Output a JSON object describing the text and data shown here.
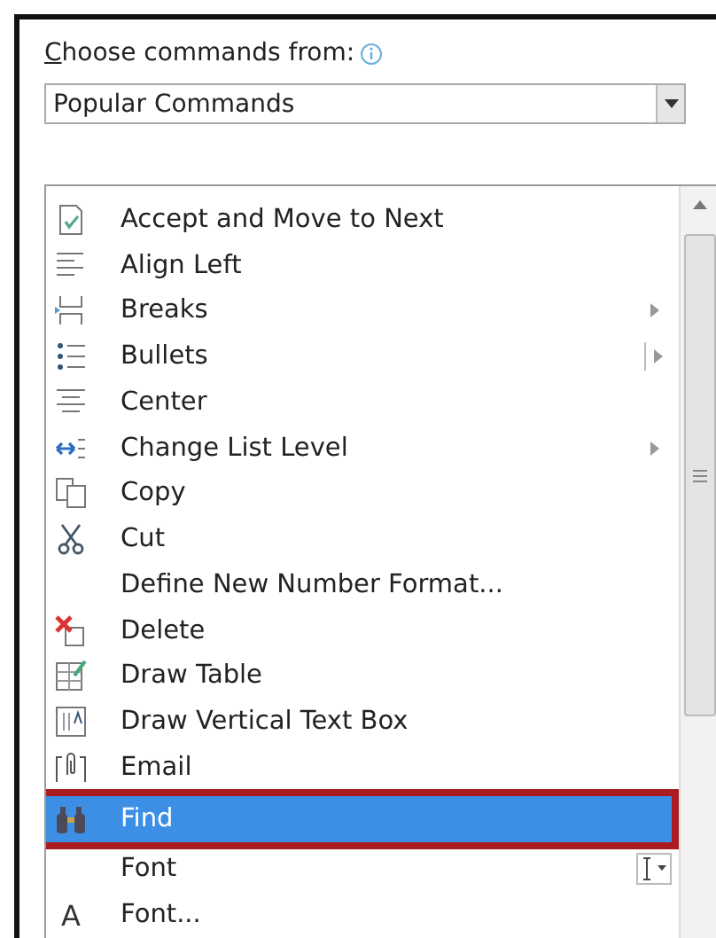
{
  "label": "Choose commands from:",
  "source": {
    "value": "Popular Commands"
  },
  "commands": [
    {
      "label": "Accept and Move to Next",
      "selected": false
    },
    {
      "label": "Align Left",
      "selected": false
    },
    {
      "label": "Breaks",
      "selected": false
    },
    {
      "label": "Bullets",
      "selected": false
    },
    {
      "label": "Center",
      "selected": false
    },
    {
      "label": "Change List Level",
      "selected": false
    },
    {
      "label": "Copy",
      "selected": false
    },
    {
      "label": "Cut",
      "selected": false
    },
    {
      "label": "Define New Number Format...",
      "selected": false
    },
    {
      "label": "Delete",
      "selected": false
    },
    {
      "label": "Draw Table",
      "selected": false
    },
    {
      "label": "Draw Vertical Text Box",
      "selected": false
    },
    {
      "label": "Email",
      "selected": false
    },
    {
      "label": "Find",
      "selected": true
    },
    {
      "label": "Font",
      "selected": false
    },
    {
      "label": "Font...",
      "glyph": "A",
      "selected": false
    }
  ]
}
